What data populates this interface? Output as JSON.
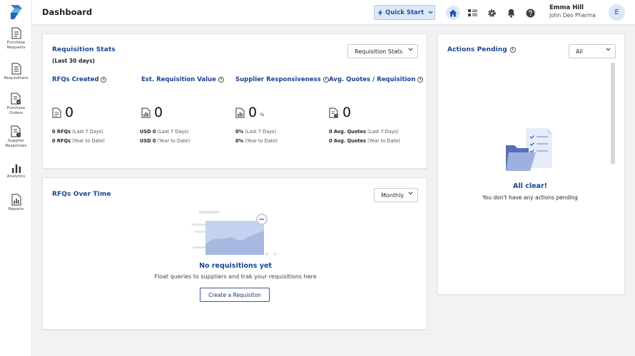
{
  "sidebar": {
    "items": [
      {
        "label_1": "Purchase",
        "label_2": "Requests"
      },
      {
        "label_1": "Requisitions"
      },
      {
        "label_1": "Purchase",
        "label_2": "Orders"
      },
      {
        "label_1": "Supplier",
        "label_2": "Responses"
      },
      {
        "label_1": "Analytics"
      },
      {
        "label_1": "Reports"
      }
    ]
  },
  "header": {
    "title": "Dashboard",
    "quick_start": "Quick Start",
    "user_name": "Emma Hill",
    "user_org": "John Deo Pharma",
    "avatar_initial": "E"
  },
  "requisition_stats": {
    "title": "Requisition Stats",
    "period": "(Last 30 days)",
    "dropdown": "Requisition Stats",
    "info_glyph": "i",
    "stats": [
      {
        "label": "RFQs Created",
        "value": "0",
        "unit": "",
        "l1_bold": "0 RFQs",
        "l1_rest": " (Last 7 Days)",
        "l2_bold": "0 RFQs",
        "l2_rest": " (Year to Date)"
      },
      {
        "label": "Est. Requisition Value",
        "value": "0",
        "unit": "",
        "l1_bold": "USD  0",
        "l1_rest": "  (Last 7 Days)",
        "l2_bold": "USD  0",
        "l2_rest": "  (Year to Date)"
      },
      {
        "label": "Supplier Responsiveness",
        "value": "0",
        "unit": "%",
        "l1_bold": "0%",
        "l1_rest": " (Last 7 Days)",
        "l2_bold": "0%",
        "l2_rest": " (Year to Date)"
      },
      {
        "label": "Avg. Quotes / Requisition",
        "value": "0",
        "unit": "",
        "l1_bold": "0 Avg. Quotes",
        "l1_rest": " (Last 7 Days)",
        "l2_bold": "0 Avg. Quotes",
        "l2_rest": " (Year to Date)"
      }
    ]
  },
  "rfqs_over_time": {
    "title": "RFQs Over Time",
    "dropdown": "Monthly",
    "empty_title": "No requisitions yet",
    "empty_desc": "Float queries to suppliers and trak your requisitions here",
    "button": "Create a Requisiton"
  },
  "actions_pending": {
    "title": "Actions Pending",
    "info_glyph": "i",
    "dropdown": "All",
    "empty_title": "All clear!",
    "empty_desc": "You don't have any actions pending"
  },
  "colors": {
    "accent": "#1a4494",
    "quick_start_bg": "#dde8f7",
    "page_bg": "#f1f2f4"
  },
  "icons": [
    "logo-icon",
    "document-icon",
    "chart-doc-icon",
    "home-icon",
    "list-icon",
    "gear-icon",
    "bell-icon",
    "help-icon",
    "bolt-icon",
    "chevron-down-icon",
    "info-icon"
  ]
}
